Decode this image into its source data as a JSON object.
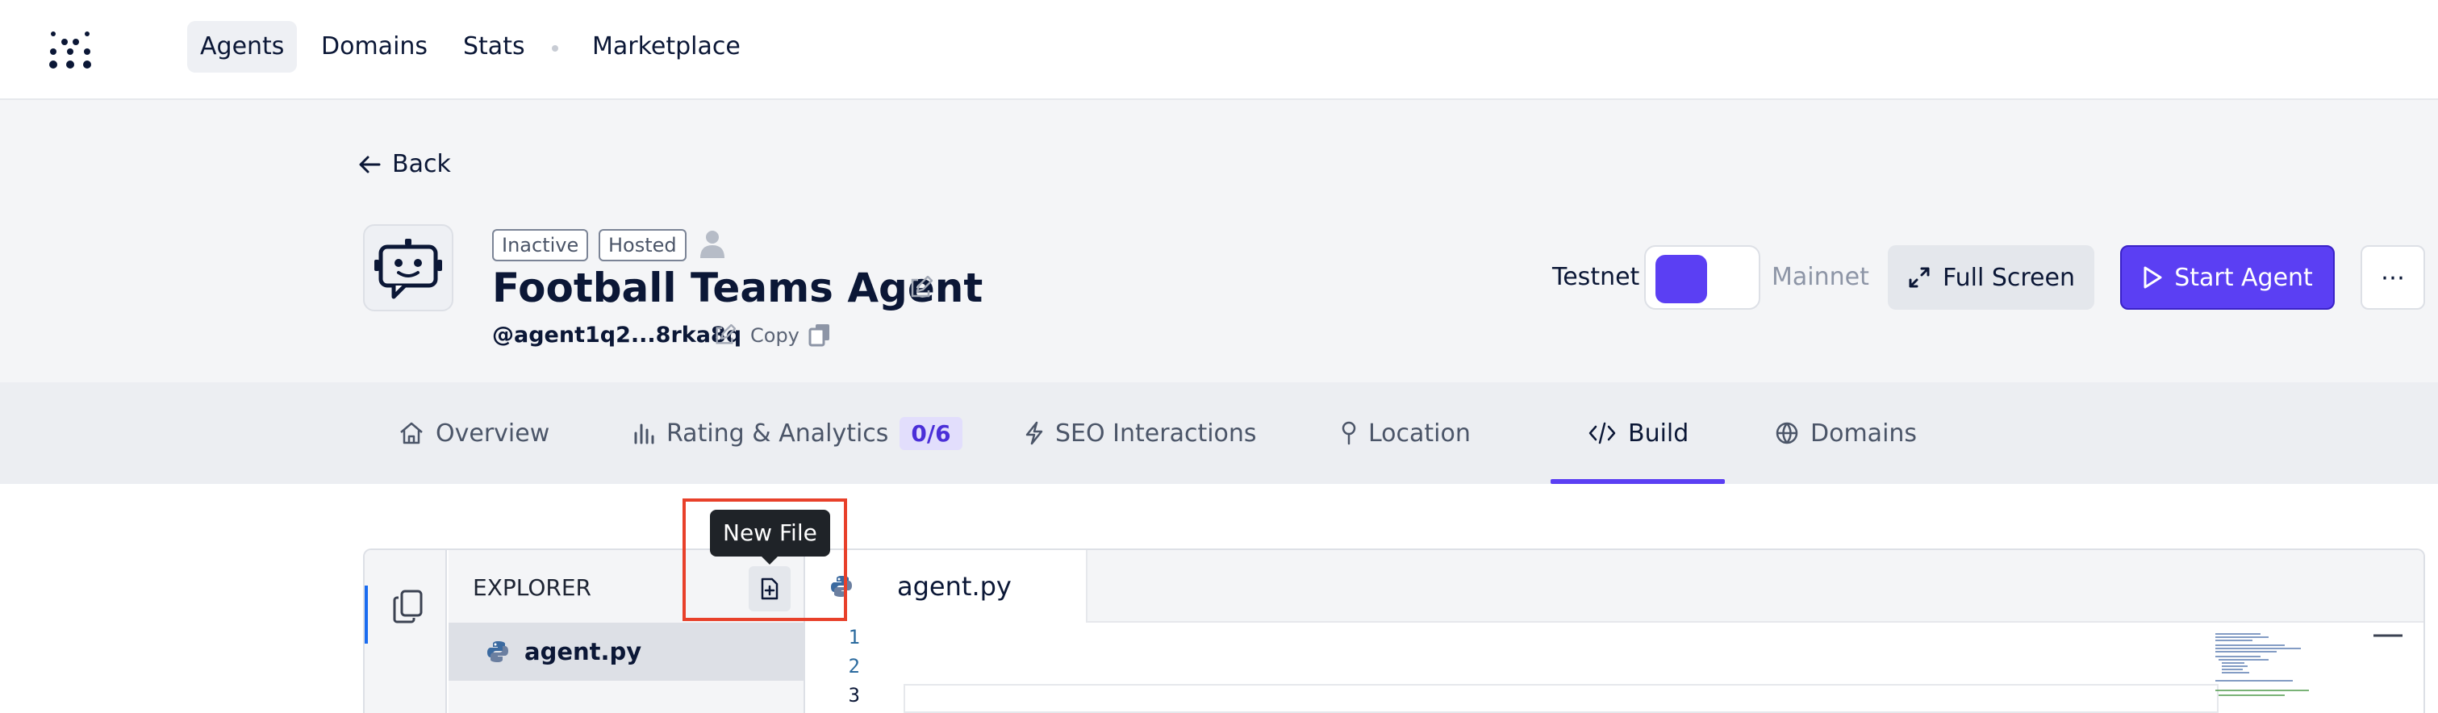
{
  "nav": {
    "items": [
      {
        "label": "Agents",
        "active": true
      },
      {
        "label": "Domains",
        "active": false
      },
      {
        "label": "Stats",
        "active": false
      },
      {
        "label": "Marketplace",
        "active": false
      }
    ]
  },
  "header": {
    "back_label": "Back",
    "badges": [
      "Inactive",
      "Hosted"
    ],
    "agent_name": "Football Teams Agent",
    "address": "@agent1q2...8rka8q",
    "copy_label": "Copy",
    "network": {
      "left_label": "Testnet",
      "right_label": "Mainnet",
      "selected": "Testnet"
    },
    "full_screen_label": "Full Screen",
    "start_agent_label": "Start Agent",
    "more_label": "⋯"
  },
  "tabs": [
    {
      "label": "Overview",
      "icon": "home-icon"
    },
    {
      "label": "Rating & Analytics",
      "icon": "bar-chart-icon",
      "count": "0/6"
    },
    {
      "label": "SEO Interactions",
      "icon": "bolt-icon"
    },
    {
      "label": "Location",
      "icon": "pin-icon"
    },
    {
      "label": "Build",
      "icon": "code-icon",
      "active": true
    },
    {
      "label": "Domains",
      "icon": "globe-icon"
    }
  ],
  "ide": {
    "explorer_title": "EXPLORER",
    "files": [
      {
        "name": "agent.py",
        "selected": true
      }
    ],
    "open_tab": "agent.py",
    "line_numbers": [
      "1",
      "2",
      "3"
    ],
    "current_line": "3",
    "tooltip": "New File"
  },
  "colors": {
    "accent": "#5b3ff3",
    "highlight": "#e8402a"
  }
}
